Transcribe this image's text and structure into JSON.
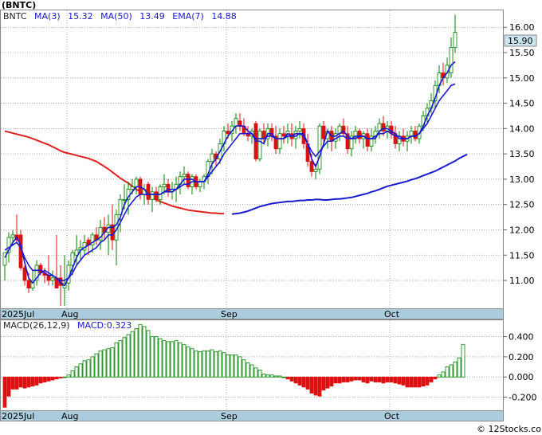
{
  "title": "(BNTC)",
  "watermark": "© 12Stocks.com",
  "main_legend": [
    {
      "label": "BNTC",
      "color": "#222222"
    },
    {
      "label": "MA(3)",
      "color": "#1a1acc"
    },
    {
      "label": "15.32",
      "color": "#1a1acc"
    },
    {
      "label": "MA(50)",
      "color": "#1a1acc"
    },
    {
      "label": "13.49",
      "color": "#1a1acc"
    },
    {
      "label": "EMA(7)",
      "color": "#1a1acc"
    },
    {
      "label": "14.88",
      "color": "#1a1acc"
    }
  ],
  "macd_legend": [
    {
      "label": "MACD(26,12,9)",
      "color": "#222222"
    },
    {
      "label": "MACD:0.323",
      "color": "#1a1acc"
    }
  ],
  "price_tag": "15.90",
  "x_labels": [
    "2025Jul",
    "Aug",
    "Sep",
    "Oct"
  ],
  "colors": {
    "up": "#008000",
    "down": "#dd1111",
    "ma3": "#1a1acc",
    "ema7": "#1a1acc",
    "ma50": "#dd2222",
    "long_ma": "#1a1acc",
    "axis_band": "#aaccdd",
    "price_tag_bg": "#cce6f0"
  },
  "chart_data": [
    {
      "type": "candlestick",
      "title": "(BNTC)",
      "ylim": [
        10.45,
        16.35
      ],
      "y_ticks": [
        11.0,
        11.5,
        12.0,
        12.5,
        13.0,
        13.5,
        14.0,
        14.5,
        15.0,
        15.5,
        16.0
      ],
      "month_starts": {
        "2025Jul": 0,
        "Aug": 16,
        "Sep": 56,
        "Oct": 97
      },
      "ohlc": [
        [
          11.3,
          11.55,
          11.0,
          11.55
        ],
        [
          11.55,
          11.95,
          11.35,
          11.85
        ],
        [
          11.85,
          12.0,
          11.7,
          11.9
        ],
        [
          11.9,
          12.3,
          11.75,
          11.8
        ],
        [
          11.9,
          12.0,
          11.2,
          11.25
        ],
        [
          11.25,
          11.3,
          10.9,
          11.0
        ],
        [
          11.0,
          11.15,
          10.75,
          10.85
        ],
        [
          10.85,
          11.2,
          10.8,
          11.0
        ],
        [
          11.0,
          11.4,
          10.9,
          11.3
        ],
        [
          11.3,
          11.35,
          11.1,
          11.15
        ],
        [
          11.15,
          11.25,
          10.95,
          11.1
        ],
        [
          11.1,
          11.5,
          10.9,
          11.0
        ],
        [
          11.0,
          11.2,
          10.9,
          11.05
        ],
        [
          11.05,
          11.9,
          10.95,
          10.85
        ],
        [
          11.05,
          11.3,
          10.5,
          10.9
        ],
        [
          10.85,
          11.5,
          10.5,
          10.95
        ],
        [
          10.95,
          11.4,
          10.8,
          11.3
        ],
        [
          11.3,
          11.6,
          11.1,
          11.55
        ],
        [
          11.5,
          11.9,
          11.3,
          11.6
        ],
        [
          11.6,
          11.8,
          11.4,
          11.65
        ],
        [
          11.6,
          11.9,
          11.5,
          11.75
        ],
        [
          11.8,
          11.85,
          11.5,
          11.7
        ],
        [
          11.7,
          11.95,
          11.55,
          11.9
        ],
        [
          11.9,
          12.05,
          11.7,
          11.8
        ],
        [
          11.8,
          12.2,
          11.6,
          12.05
        ],
        [
          12.05,
          12.25,
          11.8,
          11.95
        ],
        [
          11.95,
          12.3,
          11.5,
          12.1
        ],
        [
          12.1,
          12.5,
          11.6,
          11.8
        ],
        [
          11.8,
          12.4,
          11.3,
          12.3
        ],
        [
          12.3,
          12.7,
          11.95,
          12.6
        ],
        [
          12.6,
          12.9,
          12.4,
          12.6
        ],
        [
          12.6,
          12.95,
          12.3,
          12.8
        ],
        [
          12.8,
          13.0,
          12.7,
          12.85
        ],
        [
          12.85,
          13.05,
          12.7,
          13.0
        ],
        [
          13.0,
          13.05,
          12.6,
          12.7
        ],
        [
          12.7,
          12.9,
          12.5,
          12.8
        ],
        [
          12.9,
          12.95,
          12.5,
          12.6
        ],
        [
          12.6,
          12.85,
          12.35,
          12.75
        ],
        [
          12.75,
          12.85,
          12.55,
          12.6
        ],
        [
          12.6,
          12.9,
          12.5,
          12.85
        ],
        [
          12.85,
          13.1,
          12.7,
          12.9
        ],
        [
          12.9,
          13.0,
          12.65,
          12.75
        ],
        [
          12.75,
          12.95,
          12.6,
          12.8
        ],
        [
          12.8,
          13.05,
          12.55,
          12.9
        ],
        [
          12.9,
          13.15,
          12.7,
          13.05
        ],
        [
          13.05,
          13.25,
          12.9,
          13.1
        ],
        [
          13.1,
          13.15,
          12.8,
          12.85
        ],
        [
          12.85,
          13.1,
          12.7,
          13.05
        ],
        [
          13.05,
          13.1,
          12.8,
          12.85
        ],
        [
          12.85,
          13.0,
          12.75,
          12.95
        ],
        [
          12.95,
          13.1,
          12.8,
          13.05
        ],
        [
          13.05,
          13.4,
          12.9,
          13.35
        ],
        [
          13.35,
          13.6,
          13.1,
          13.5
        ],
        [
          13.5,
          13.55,
          13.25,
          13.4
        ],
        [
          13.4,
          13.8,
          13.3,
          13.7
        ],
        [
          13.7,
          14.05,
          13.55,
          13.95
        ],
        [
          13.95,
          14.1,
          13.8,
          13.9
        ],
        [
          13.9,
          14.15,
          13.75,
          14.05
        ],
        [
          14.05,
          14.3,
          13.9,
          14.2
        ],
        [
          14.15,
          14.3,
          13.95,
          14.05
        ],
        [
          14.05,
          14.2,
          13.85,
          13.9
        ],
        [
          13.9,
          14.05,
          13.75,
          13.85
        ],
        [
          13.85,
          14.0,
          13.7,
          13.95
        ],
        [
          14.1,
          14.15,
          13.35,
          13.4
        ],
        [
          13.4,
          14.0,
          13.35,
          13.95
        ],
        [
          13.95,
          14.1,
          13.7,
          13.8
        ],
        [
          13.8,
          14.1,
          13.65,
          14.0
        ],
        [
          14.0,
          14.1,
          13.75,
          13.85
        ],
        [
          13.85,
          14.05,
          13.5,
          13.6
        ],
        [
          13.6,
          14.0,
          13.5,
          13.9
        ],
        [
          13.9,
          14.05,
          13.7,
          13.85
        ],
        [
          13.85,
          14.1,
          13.7,
          13.95
        ],
        [
          13.9,
          14.1,
          13.65,
          13.8
        ],
        [
          13.8,
          14.05,
          13.6,
          13.95
        ],
        [
          13.95,
          14.15,
          13.8,
          14.0
        ],
        [
          14.0,
          14.1,
          13.6,
          13.7
        ],
        [
          13.7,
          13.9,
          13.25,
          13.35
        ],
        [
          13.35,
          13.5,
          13.05,
          13.15
        ],
        [
          13.15,
          13.3,
          13.0,
          13.2
        ],
        [
          13.2,
          14.1,
          13.1,
          14.05
        ],
        [
          14.05,
          14.15,
          13.7,
          13.8
        ],
        [
          13.8,
          14.0,
          13.6,
          13.95
        ],
        [
          13.95,
          14.05,
          13.55,
          13.75
        ],
        [
          13.75,
          14.0,
          13.6,
          13.9
        ],
        [
          13.9,
          14.1,
          13.75,
          14.05
        ],
        [
          14.05,
          14.2,
          13.85,
          13.9
        ],
        [
          13.9,
          14.05,
          13.5,
          13.6
        ],
        [
          13.6,
          13.95,
          13.45,
          13.85
        ],
        [
          13.85,
          14.05,
          13.7,
          13.95
        ],
        [
          13.95,
          14.0,
          13.7,
          13.8
        ],
        [
          13.8,
          13.95,
          13.6,
          13.9
        ],
        [
          13.9,
          14.0,
          13.55,
          13.65
        ],
        [
          13.65,
          14.0,
          13.55,
          13.85
        ],
        [
          13.85,
          14.05,
          13.7,
          13.95
        ],
        [
          13.95,
          14.2,
          13.8,
          14.1
        ],
        [
          14.1,
          14.25,
          13.85,
          13.95
        ],
        [
          13.95,
          14.15,
          13.8,
          14.05
        ],
        [
          14.05,
          14.15,
          13.8,
          13.9
        ],
        [
          13.9,
          14.05,
          13.6,
          13.7
        ],
        [
          13.7,
          13.95,
          13.55,
          13.85
        ],
        [
          13.85,
          14.0,
          13.65,
          13.75
        ],
        [
          13.75,
          13.95,
          13.55,
          13.85
        ],
        [
          13.85,
          14.05,
          13.7,
          13.95
        ],
        [
          13.95,
          14.05,
          13.75,
          13.8
        ],
        [
          13.8,
          14.1,
          13.7,
          14.05
        ],
        [
          14.05,
          14.35,
          13.95,
          14.25
        ],
        [
          14.25,
          14.5,
          14.1,
          14.4
        ],
        [
          14.4,
          14.7,
          14.3,
          14.55
        ],
        [
          14.55,
          14.95,
          14.4,
          14.85
        ],
        [
          14.85,
          15.25,
          14.7,
          15.1
        ],
        [
          15.1,
          15.3,
          14.85,
          15.0
        ],
        [
          15.0,
          15.4,
          14.9,
          15.25
        ],
        [
          15.1,
          15.8,
          15.0,
          15.6
        ],
        [
          15.6,
          16.25,
          15.5,
          15.9
        ]
      ],
      "ma3": [
        11.45,
        11.6,
        11.75,
        11.85,
        11.7,
        11.35,
        11.05,
        10.95,
        11.05,
        11.15,
        11.2,
        11.15,
        11.1,
        11.05,
        10.95,
        10.9,
        11.05,
        11.25,
        11.45,
        11.6,
        11.65,
        11.7,
        11.75,
        11.8,
        11.85,
        11.95,
        12.05,
        12.05,
        12.1,
        12.25,
        12.5,
        12.65,
        12.75,
        12.85,
        12.85,
        12.8,
        12.7,
        12.7,
        12.7,
        12.7,
        12.75,
        12.8,
        12.8,
        12.8,
        12.9,
        13.0,
        13.0,
        13.0,
        12.95,
        12.95,
        12.95,
        13.1,
        13.3,
        13.4,
        13.55,
        13.7,
        13.85,
        13.95,
        14.05,
        14.05,
        14.05,
        13.95,
        13.9,
        13.75,
        13.75,
        13.7,
        13.9,
        13.9,
        13.8,
        13.8,
        13.8,
        13.9,
        13.85,
        13.9,
        13.9,
        13.9,
        13.7,
        13.4,
        13.25,
        13.45,
        13.7,
        13.95,
        13.85,
        13.85,
        13.9,
        13.95,
        13.85,
        13.8,
        13.8,
        13.85,
        13.85,
        13.8,
        13.8,
        13.8,
        13.95,
        14.0,
        14.0,
        13.95,
        13.9,
        13.8,
        13.8,
        13.8,
        13.85,
        13.85,
        13.9,
        14.05,
        14.25,
        14.4,
        14.6,
        14.85,
        15.0,
        15.1,
        15.25,
        15.32
      ],
      "ema7": [
        11.6,
        11.65,
        11.7,
        11.75,
        11.65,
        11.45,
        11.3,
        11.2,
        11.2,
        11.2,
        11.15,
        11.1,
        11.1,
        11.05,
        11.0,
        11.0,
        11.05,
        11.15,
        11.3,
        11.4,
        11.5,
        11.55,
        11.6,
        11.65,
        11.75,
        11.8,
        11.9,
        11.9,
        12.0,
        12.15,
        12.3,
        12.45,
        12.55,
        12.65,
        12.7,
        12.7,
        12.7,
        12.7,
        12.7,
        12.7,
        12.75,
        12.75,
        12.75,
        12.8,
        12.85,
        12.9,
        12.9,
        12.95,
        12.95,
        12.95,
        12.95,
        13.05,
        13.15,
        13.25,
        13.35,
        13.5,
        13.6,
        13.7,
        13.8,
        13.9,
        13.9,
        13.9,
        13.9,
        13.8,
        13.8,
        13.8,
        13.85,
        13.85,
        13.8,
        13.8,
        13.8,
        13.85,
        13.85,
        13.85,
        13.9,
        13.85,
        13.7,
        13.55,
        13.45,
        13.55,
        13.65,
        13.75,
        13.75,
        13.8,
        13.85,
        13.85,
        13.8,
        13.8,
        13.85,
        13.85,
        13.85,
        13.8,
        13.8,
        13.85,
        13.9,
        13.9,
        13.95,
        13.9,
        13.85,
        13.85,
        13.8,
        13.8,
        13.85,
        13.85,
        13.9,
        14.0,
        14.1,
        14.25,
        14.4,
        14.55,
        14.65,
        14.75,
        14.85,
        14.88
      ],
      "ma50": [
        13.95,
        13.93,
        13.91,
        13.89,
        13.87,
        13.85,
        13.83,
        13.8,
        13.77,
        13.74,
        13.71,
        13.68,
        13.64,
        13.6,
        13.56,
        13.53,
        13.51,
        13.49,
        13.47,
        13.45,
        13.43,
        13.41,
        13.38,
        13.35,
        13.3,
        13.25,
        13.2,
        13.14,
        13.08,
        13.02,
        12.97,
        12.92,
        12.86,
        12.8,
        12.75,
        12.71,
        12.67,
        12.63,
        12.59,
        12.56,
        12.53,
        12.5,
        12.47,
        12.45,
        12.43,
        12.41,
        12.39,
        12.38,
        12.37,
        12.36,
        12.35,
        12.34,
        12.33,
        12.33,
        12.32,
        12.32
      ],
      "long_ma_start_index": 57,
      "long_ma": [
        12.31,
        12.32,
        12.33,
        12.35,
        12.37,
        12.4,
        12.43,
        12.46,
        12.48,
        12.5,
        12.52,
        12.53,
        12.54,
        12.55,
        12.56,
        12.56,
        12.57,
        12.58,
        12.58,
        12.59,
        12.59,
        12.6,
        12.6,
        12.59,
        12.59,
        12.6,
        12.61,
        12.61,
        12.62,
        12.63,
        12.64,
        12.66,
        12.68,
        12.7,
        12.72,
        12.75,
        12.77,
        12.8,
        12.83,
        12.86,
        12.88,
        12.9,
        12.92,
        12.94,
        12.96,
        12.99,
        13.01,
        13.04,
        13.07,
        13.1,
        13.13,
        13.16,
        13.2,
        13.24,
        13.28,
        13.32,
        13.36,
        13.41,
        13.45,
        13.49
      ]
    },
    {
      "type": "bar",
      "title": "MACD(26,12,9)",
      "ylim": [
        -0.33,
        0.57
      ],
      "y_ticks": [
        -0.2,
        0.0,
        0.2,
        0.4
      ],
      "values": [
        -0.3,
        -0.19,
        -0.12,
        -0.12,
        -0.1,
        -0.11,
        -0.1,
        -0.09,
        -0.08,
        -0.06,
        -0.05,
        -0.04,
        -0.03,
        -0.02,
        -0.01,
        0.0,
        0.02,
        0.06,
        0.1,
        0.13,
        0.16,
        0.17,
        0.2,
        0.23,
        0.26,
        0.27,
        0.28,
        0.29,
        0.34,
        0.36,
        0.39,
        0.42,
        0.45,
        0.48,
        0.52,
        0.5,
        0.46,
        0.4,
        0.4,
        0.38,
        0.36,
        0.35,
        0.35,
        0.36,
        0.34,
        0.32,
        0.3,
        0.28,
        0.26,
        0.25,
        0.26,
        0.26,
        0.27,
        0.25,
        0.26,
        0.24,
        0.22,
        0.22,
        0.22,
        0.2,
        0.17,
        0.14,
        0.12,
        0.09,
        0.07,
        0.03,
        0.02,
        0.02,
        0.01,
        0.01,
        0.0,
        -0.02,
        -0.04,
        -0.06,
        -0.08,
        -0.1,
        -0.12,
        -0.16,
        -0.18,
        -0.19,
        -0.13,
        -0.11,
        -0.09,
        -0.06,
        -0.06,
        -0.05,
        -0.05,
        -0.04,
        -0.03,
        -0.03,
        -0.05,
        -0.06,
        -0.04,
        -0.05,
        -0.05,
        -0.06,
        -0.05,
        -0.05,
        -0.06,
        -0.07,
        -0.08,
        -0.1,
        -0.1,
        -0.1,
        -0.1,
        -0.09,
        -0.08,
        -0.05,
        -0.02,
        0.02,
        0.05,
        0.1,
        0.12,
        0.15,
        0.19,
        0.323
      ]
    }
  ]
}
